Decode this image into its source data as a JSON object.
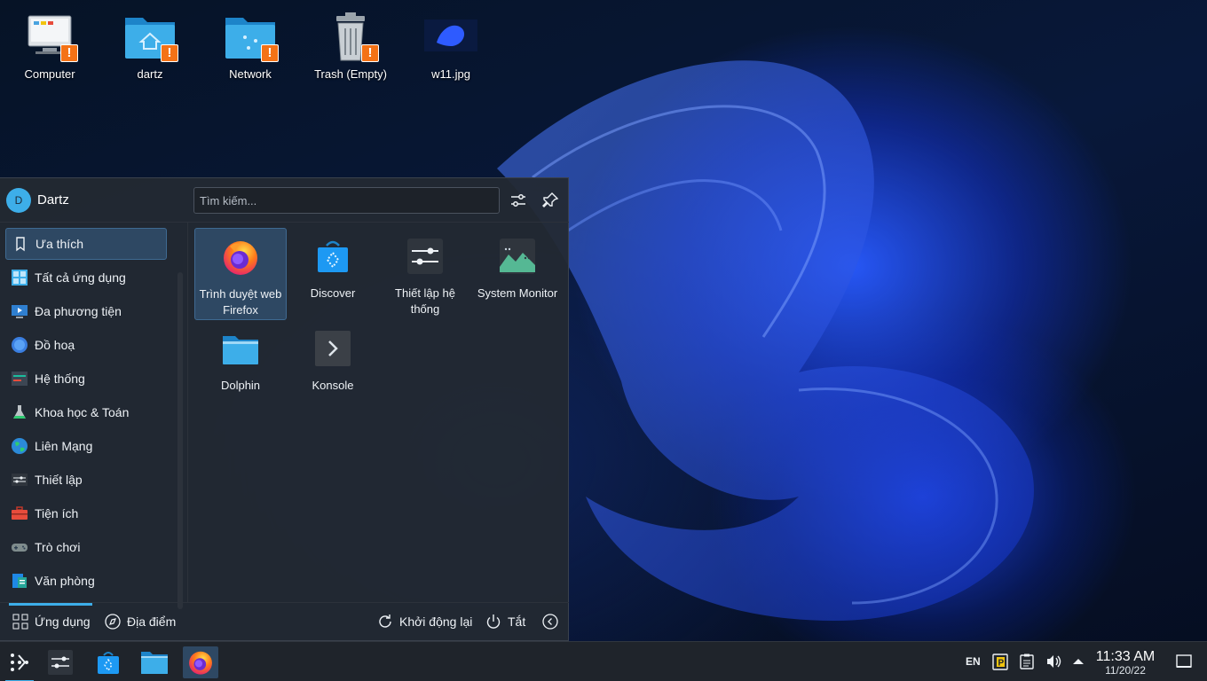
{
  "desktop": {
    "icons": [
      {
        "label": "Computer",
        "icon": "computer-icon"
      },
      {
        "label": "dartz",
        "icon": "home-folder-icon"
      },
      {
        "label": "Network",
        "icon": "network-folder-icon"
      },
      {
        "label": "Trash (Empty)",
        "icon": "trash-icon"
      },
      {
        "label": "w11.jpg",
        "icon": "image-file-icon"
      }
    ]
  },
  "launcher": {
    "user": {
      "name": "Dartz",
      "initial": "D"
    },
    "search": {
      "placeholder": "Tìm kiếm..."
    },
    "categories": [
      {
        "label": "Ưa thích",
        "icon": "bookmark-icon",
        "active": true
      },
      {
        "label": "Tất cả ứng dụng",
        "icon": "all-apps-icon"
      },
      {
        "label": "Đa phương tiện",
        "icon": "multimedia-icon"
      },
      {
        "label": "Đồ hoạ",
        "icon": "graphics-icon"
      },
      {
        "label": "Hệ thống",
        "icon": "system-icon"
      },
      {
        "label": "Khoa học & Toán",
        "icon": "science-icon"
      },
      {
        "label": "Liên Mạng",
        "icon": "internet-icon"
      },
      {
        "label": "Thiết lập",
        "icon": "settings-icon"
      },
      {
        "label": "Tiện ích",
        "icon": "utilities-icon"
      },
      {
        "label": "Trò chơi",
        "icon": "games-icon"
      },
      {
        "label": "Văn phòng",
        "icon": "office-icon"
      }
    ],
    "favorites": [
      {
        "label": "Trình duyệt web Firefox",
        "icon": "firefox-icon",
        "active": true
      },
      {
        "label": "Discover",
        "icon": "discover-icon"
      },
      {
        "label": "Thiết lập hệ thống",
        "icon": "system-settings-icon"
      },
      {
        "label": "System Monitor",
        "icon": "system-monitor-icon"
      },
      {
        "label": "Dolphin",
        "icon": "dolphin-icon"
      },
      {
        "label": "Konsole",
        "icon": "konsole-icon"
      }
    ],
    "footer": {
      "applications": "Ứng dụng",
      "places": "Địa điểm",
      "restart": "Khởi động lại",
      "shutdown": "Tắt"
    }
  },
  "taskbar": {
    "tasks": [
      "app-launcher-icon",
      "system-settings-icon",
      "discover-icon",
      "dolphin-icon",
      "firefox-icon"
    ],
    "tray": {
      "keyboard_layout": "EN"
    },
    "clock": {
      "time": "11:33 AM",
      "date": "11/20/22"
    }
  },
  "colors": {
    "accent": "#3daee9",
    "selection": "#2e4863",
    "warning": "#f47216"
  }
}
